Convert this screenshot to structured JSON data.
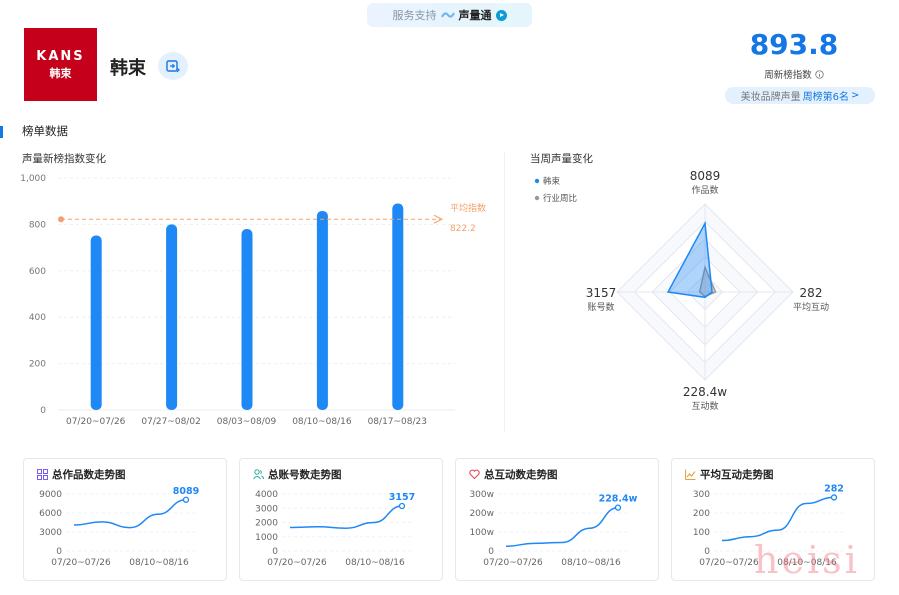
{
  "service": {
    "label": "服务支持",
    "product": "声量通"
  },
  "brand": {
    "logo_top": "KANS",
    "logo_bottom": "韩束",
    "name": "韩束"
  },
  "score": {
    "value": "893.8",
    "label": "周新榜指数",
    "rank_prefix": "美妆品牌声量",
    "rank_link": "周榜第6名",
    "rank_arrow": ">"
  },
  "section": {
    "title": "榜单数据"
  },
  "bar_chart_title": "声量新榜指数变化",
  "radar_title": "当周声量变化",
  "chart_data": [
    {
      "type": "bar",
      "categories": [
        "07/20~07/26",
        "07/27~08/02",
        "08/03~08/09",
        "08/10~08/16",
        "08/17~08/23"
      ],
      "values": [
        752,
        800,
        780,
        858,
        890
      ],
      "ylim": [
        0,
        1000
      ],
      "yticks": [
        "0",
        "200",
        "400",
        "600",
        "800",
        "1,000"
      ],
      "reference_line": {
        "label": "平均指数",
        "value": 822.2,
        "value_label": "822.2"
      },
      "colors": {
        "bar": "#1e88f5",
        "reference": "#f5a06b"
      }
    },
    {
      "type": "radar",
      "axes": [
        {
          "name": "作品数",
          "value_label": "8089"
        },
        {
          "name": "平均互动",
          "value_label": "282"
        },
        {
          "name": "互动数",
          "value_label": "228.4w"
        },
        {
          "name": "账号数",
          "value_label": "3157"
        }
      ],
      "series": [
        {
          "name": "韩束",
          "values": [
            0.78,
            0.08,
            0.06,
            0.42
          ],
          "color": "#1e88f5"
        },
        {
          "name": "行业周比",
          "values": [
            0.28,
            0.12,
            0.05,
            0.06
          ],
          "color": "#999999"
        }
      ]
    },
    {
      "type": "line",
      "title": "总作品数走势图",
      "x": [
        "07/20~07/26",
        "07/27~08/02",
        "08/03~08/09",
        "08/10~08/16",
        "08/17~08/23"
      ],
      "values": [
        4100,
        4600,
        3700,
        5800,
        8089
      ],
      "ylim": [
        0,
        9000
      ],
      "yticks": [
        "0",
        "3000",
        "6000",
        "9000"
      ],
      "xticks": [
        "07/20~07/26",
        "08/10~08/16"
      ],
      "end_label": "8089"
    },
    {
      "type": "line",
      "title": "总账号数走势图",
      "x": [
        "07/20~07/26",
        "07/27~08/02",
        "08/03~08/09",
        "08/10~08/16",
        "08/17~08/23"
      ],
      "values": [
        1650,
        1700,
        1600,
        2000,
        3157
      ],
      "ylim": [
        0,
        4000
      ],
      "yticks": [
        "0",
        "1000",
        "2000",
        "3000",
        "4000"
      ],
      "xticks": [
        "07/20~07/26",
        "08/10~08/16"
      ],
      "end_label": "3157"
    },
    {
      "type": "line",
      "title": "总互动数走势图",
      "x": [
        "07/20~07/26",
        "07/27~08/02",
        "08/03~08/09",
        "08/10~08/16",
        "08/17~08/23"
      ],
      "values": [
        25,
        40,
        45,
        120,
        228.4
      ],
      "ylim": [
        0,
        300
      ],
      "yticks": [
        "0",
        "100w",
        "200w",
        "300w"
      ],
      "xticks": [
        "07/20~07/26",
        "08/10~08/16"
      ],
      "end_label": "228.4w"
    },
    {
      "type": "line",
      "title": "平均互动走势图",
      "x": [
        "07/20~07/26",
        "07/27~08/02",
        "08/03~08/09",
        "08/10~08/16",
        "08/17~08/23"
      ],
      "values": [
        55,
        75,
        110,
        250,
        282
      ],
      "ylim": [
        0,
        300
      ],
      "yticks": [
        "0",
        "100",
        "200",
        "300"
      ],
      "xticks": [
        "07/20~07/26",
        "08/10~08/16"
      ],
      "end_label": "282"
    }
  ],
  "watermark": "heisi",
  "colors": {
    "accent": "#1477e5",
    "logo_bg": "#c4001a"
  },
  "icons": {
    "works": "grid-icon",
    "accounts": "users-icon",
    "interactions": "heart-icon",
    "avg": "trend-icon"
  }
}
